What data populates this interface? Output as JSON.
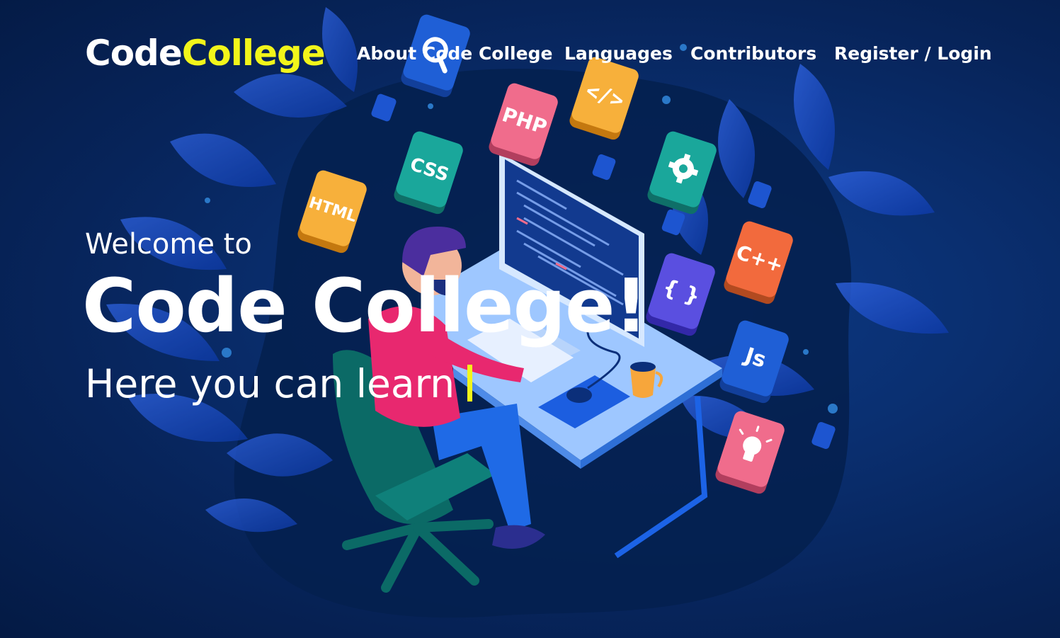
{
  "brand": {
    "part1": "Code",
    "part2": "College"
  },
  "nav": {
    "items": [
      {
        "label": "About Code College"
      },
      {
        "label": "Languages"
      },
      {
        "label": "Contributors"
      },
      {
        "label": "Register / Login"
      }
    ]
  },
  "hero": {
    "welcome": "Welcome to",
    "title": "Code College!",
    "tagline": "Here you can learn"
  },
  "illustration": {
    "tiles": [
      {
        "label": "HTML",
        "color": "#f7b03b"
      },
      {
        "label": "CSS",
        "color": "#1aa79b"
      },
      {
        "label": "PHP",
        "color": "#f06c8c"
      },
      {
        "label": "</>",
        "color": "#f7b03b"
      },
      {
        "label": "settings",
        "icon": "gear-icon",
        "color": "#1aa79b"
      },
      {
        "label": "{ }",
        "color": "#5a4fe0"
      },
      {
        "label": "C++",
        "color": "#f26a3d"
      },
      {
        "label": "Js",
        "color": "#1f5fd6"
      },
      {
        "label": "idea",
        "icon": "lightbulb-icon",
        "color": "#f06c8c"
      },
      {
        "label": "search",
        "icon": "search-icon",
        "color": "#1f5fd6"
      }
    ]
  },
  "colors": {
    "accent": "#f2f51a",
    "background": "#0a2f70"
  }
}
